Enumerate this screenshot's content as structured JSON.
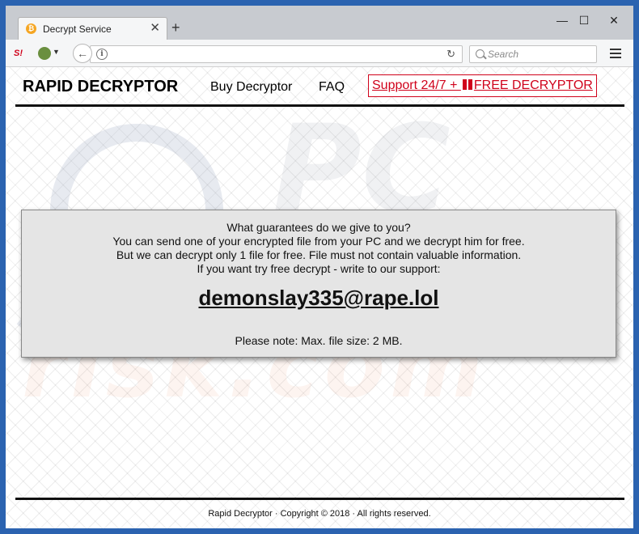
{
  "browser": {
    "tab_title": "Decrypt Service",
    "search_placeholder": "Search",
    "new_tab_glyph": "+",
    "close_glyph": "✕",
    "window_controls": {
      "minimize": "—",
      "maximize": "☐",
      "close": "✕"
    }
  },
  "header": {
    "brand": "RAPID DECRYPTOR",
    "nav_buy": "Buy Decryptor",
    "nav_faq": "FAQ",
    "support_prefix": "Support 24/7 + ",
    "support_suffix": "FREE DECRYPTOR"
  },
  "info": {
    "lines": [
      "What guarantees do we give to you?",
      "You can send one of your encrypted file from your PC and we decrypt him for free.",
      "But we can decrypt only 1 file for free. File must not contain valuable information.",
      "If you want try free decrypt - write to our support:"
    ],
    "email": "demonslay335@rape.lol",
    "note": "Please note: Max. file size: 2 MB."
  },
  "footer": {
    "text": "Rapid Decryptor · Copyright © 2018 · All rights reserved."
  },
  "colors": {
    "accent_red": "#d0021b",
    "desktop_blue": "#2b63b0",
    "box_bg": "#e5e5e5"
  }
}
